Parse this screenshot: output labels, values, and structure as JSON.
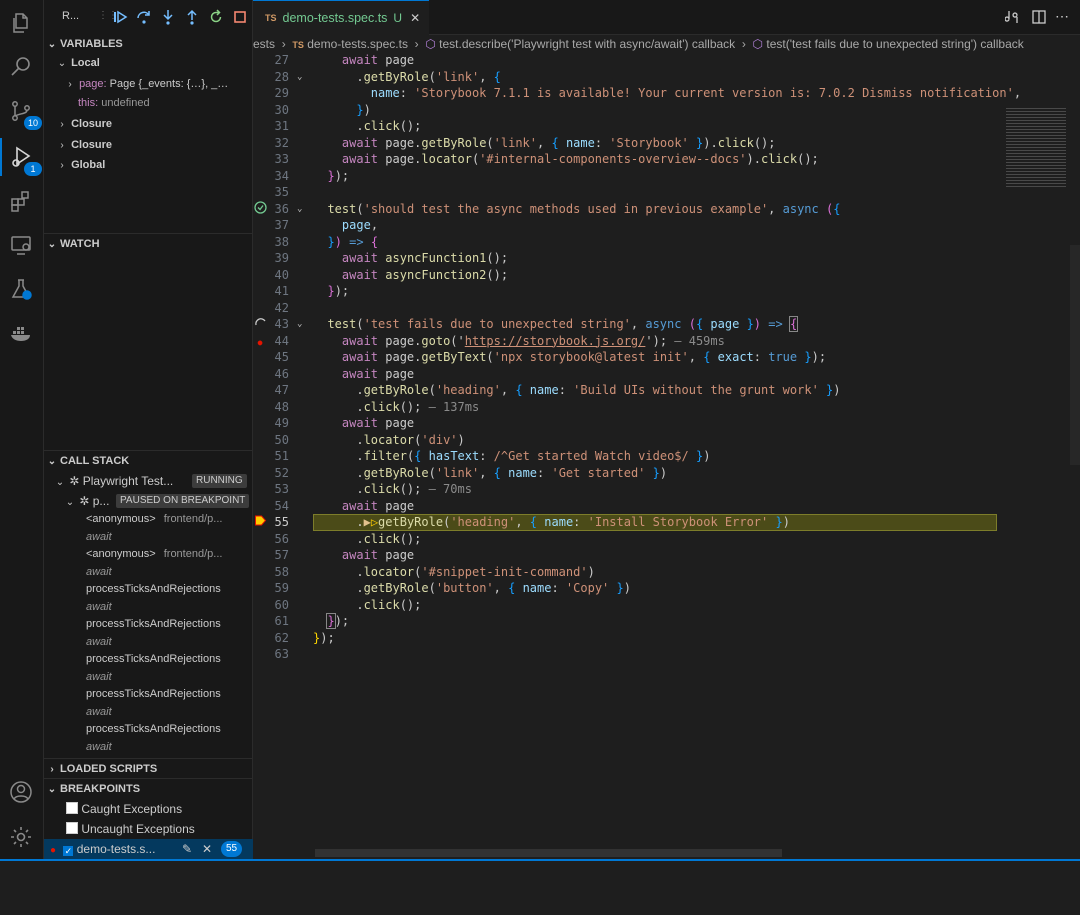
{
  "sidebar": {
    "run_title": "R...",
    "sections": {
      "variables": "VARIABLES",
      "watch": "WATCH",
      "call_stack": "CALL STACK",
      "loaded_scripts": "LOADED SCRIPTS",
      "breakpoints": "BREAKPOINTS"
    },
    "variables": {
      "local": "Local",
      "page_key": "page:",
      "page_val": "Page {_events: {…}, _…",
      "this_key": "this:",
      "this_val": "undefined",
      "closure1": "Closure",
      "closure2": "Closure",
      "global": "Global"
    },
    "call_stack": {
      "thread_name": "Playwright Test...",
      "thread_state": "RUNNING",
      "sub_name": "p...",
      "sub_state": "PAUSED ON BREAKPOINT",
      "frames": [
        {
          "name": "<anonymous>",
          "file": "frontend/p..."
        },
        {
          "name": "await",
          "file": ""
        },
        {
          "name": "<anonymous>",
          "file": "frontend/p..."
        },
        {
          "name": "await",
          "file": ""
        },
        {
          "name": "processTicksAndRejections",
          "file": ""
        },
        {
          "name": "await",
          "file": ""
        },
        {
          "name": "processTicksAndRejections",
          "file": ""
        },
        {
          "name": "await",
          "file": ""
        },
        {
          "name": "processTicksAndRejections",
          "file": ""
        },
        {
          "name": "await",
          "file": ""
        },
        {
          "name": "processTicksAndRejections",
          "file": ""
        },
        {
          "name": "await",
          "file": ""
        },
        {
          "name": "processTicksAndRejections",
          "file": ""
        },
        {
          "name": "await",
          "file": ""
        }
      ]
    },
    "breakpoints": {
      "caught": "Caught Exceptions",
      "uncaught": "Uncaught Exceptions",
      "file": "demo-tests.s...",
      "line_badge": "55"
    }
  },
  "activity": {
    "scm_badge": "10",
    "debug_badge": "1"
  },
  "tab": {
    "lang": "TS",
    "name": "demo-tests.spec.ts",
    "status": "U"
  },
  "breadcrumb": {
    "folder": "ests",
    "file_lang": "TS",
    "file": "demo-tests.spec.ts",
    "describe": "test.describe('Playwright test with async/await') callback",
    "test": "test('test fails due to unexpected string') callback"
  },
  "editor": {
    "current_line": 55,
    "line_numbers": [
      "27",
      "28",
      "29",
      "30",
      "31",
      "32",
      "33",
      "34",
      "35",
      "36",
      "37",
      "38",
      "39",
      "40",
      "41",
      "42",
      "43",
      "44",
      "45",
      "46",
      "47",
      "48",
      "49",
      "50",
      "51",
      "52",
      "53",
      "54",
      "55",
      "56",
      "57",
      "58",
      "59",
      "60",
      "61",
      "62",
      "63"
    ],
    "strings": {
      "s29": "'Storybook 7.1.1 is available! Your current version is: 7.0.2 Dismiss notification'",
      "s32": "'Storybook'",
      "s33": "'#internal-components-overview--docs'",
      "s36": "'should test the async methods used in previous example'",
      "s43": "'test fails due to unexpected string'",
      "url44": "https://storybook.js.org/",
      "t44": "— 459ms",
      "s45": "'npx storybook@latest init'",
      "s47": "'Build UIs without the grunt work'",
      "t48": "— 137ms",
      "s50": "'div'",
      "s51": "Get started Watch video",
      "s52": "'Get started'",
      "t53": "— 70ms",
      "s55": "'Install Storybook Error'",
      "s58": "'#snippet-init-command'",
      "s59": "'Copy'"
    }
  },
  "colors": {
    "accent": "#0078d4",
    "breakpoint": "#e51400",
    "paused_line": "#4b4b18",
    "pass_icon": "#73c991"
  }
}
